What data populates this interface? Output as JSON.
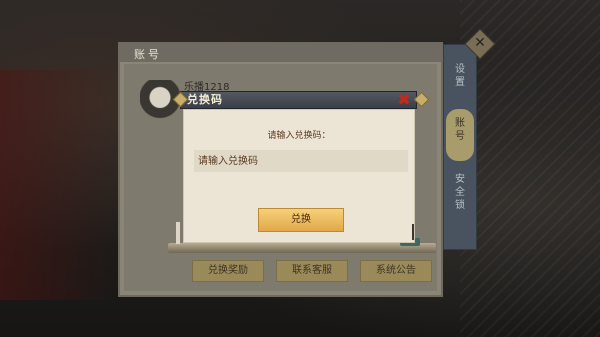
{
  "account_panel": {
    "title": "账号",
    "username": "乐播1218",
    "server": "",
    "info_line_1": "",
    "info_line_2": "",
    "buttons": [
      "兑换奖励",
      "联系客服",
      "系统公告"
    ]
  },
  "side_tabs": [
    "设置",
    "账号",
    "安全锁"
  ],
  "dialog": {
    "title": "兑换码",
    "prompt": "请输入兑换码：",
    "input_placeholder": "请输入兑换码",
    "input_value": "",
    "redeem_label": "兑换",
    "close_icon": "close-icon"
  },
  "colors": {
    "dialog_header": "#3a3e46",
    "dialog_body": "#ece5d5",
    "redeem_button": "#e2a84a",
    "close_x": "#c42a1a",
    "side_tab_active": "#a99c6c"
  }
}
